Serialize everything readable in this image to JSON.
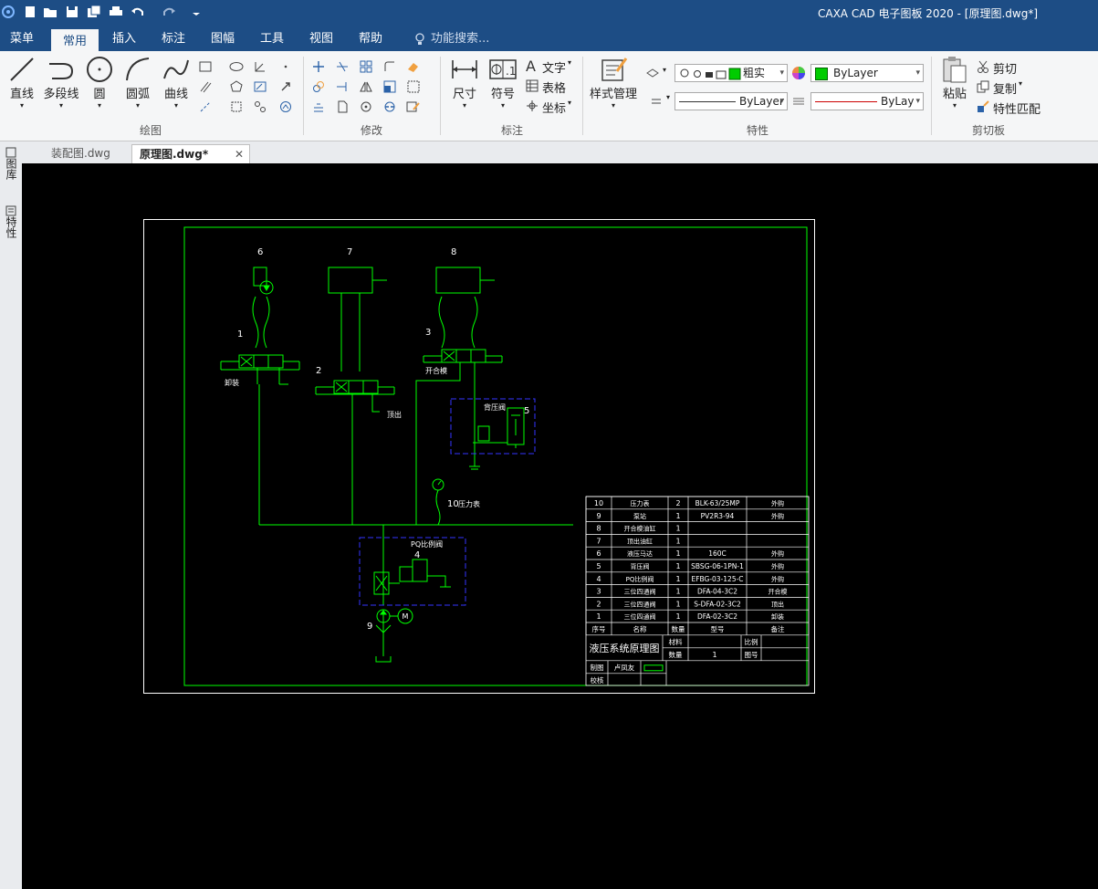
{
  "window": {
    "title": "CAXA CAD 电子图板 2020 - [原理图.dwg*]"
  },
  "quick_access": [
    "app-icon",
    "new-icon",
    "open-icon",
    "save-icon",
    "save-all-icon",
    "print-icon",
    "undo-icon",
    "redo-icon",
    "customize-icon"
  ],
  "menus": [
    "菜单",
    "常用",
    "插入",
    "标注",
    "图幅",
    "工具",
    "视图",
    "帮助"
  ],
  "active_menu": "常用",
  "search_placeholder": "功能搜索...",
  "ribbon": {
    "draw": {
      "label": "绘图",
      "big": [
        "直线",
        "多段线",
        "圆",
        "圆弧",
        "曲线"
      ]
    },
    "modify": {
      "label": "修改"
    },
    "annotate": {
      "label": "标注",
      "big": [
        "尺寸",
        "符号"
      ],
      "small": [
        "文字",
        "表格",
        "坐标"
      ]
    },
    "props": {
      "label": "特性",
      "style_btn": "样式管理",
      "layer_value": "粗实",
      "color_value": "ByLayer",
      "linetype_value": "ByLayer",
      "linewidth_value": "ByLay"
    },
    "clipboard": {
      "label": "剪切板",
      "paste": "粘贴",
      "cut": "剪切",
      "copy": "复制",
      "match": "特性匹配"
    }
  },
  "doc_tabs": [
    {
      "label": "装配图.dwg",
      "active": false
    },
    {
      "label": "原理图.dwg*",
      "active": true
    }
  ],
  "left_tabs": [
    "图库",
    "特性"
  ],
  "colors": {
    "green": "#00ff00",
    "blue": "#3535ff",
    "white": "#ffffff",
    "dark_blue": "#1d4d85"
  },
  "drawing": {
    "component_numbers": [
      "6",
      "7",
      "8",
      "1",
      "2",
      "3",
      "5",
      "4",
      "9",
      "10"
    ],
    "labels": {
      "c1": "卸装",
      "c2": "顶出",
      "c3": "开合模",
      "c5": "背压阀",
      "c4": "PQ比例阀",
      "c10": "压力表",
      "motor": "M"
    },
    "bom_rows": [
      {
        "no": "10",
        "name": "压力表",
        "qty": "2",
        "model": "BLK-63/25MP",
        "note": "外购"
      },
      {
        "no": "9",
        "name": "泵站",
        "qty": "1",
        "model": "PV2R3-94",
        "note": "外购"
      },
      {
        "no": "8",
        "name": "开合模油缸",
        "qty": "1",
        "model": "",
        "note": ""
      },
      {
        "no": "7",
        "name": "顶出油缸",
        "qty": "1",
        "model": "",
        "note": ""
      },
      {
        "no": "6",
        "name": "液压马达",
        "qty": "1",
        "model": "160C",
        "note": "外购"
      },
      {
        "no": "5",
        "name": "背压阀",
        "qty": "1",
        "model": "SBSG-06-1PN-1",
        "note": "外购"
      },
      {
        "no": "4",
        "name": "PQ比例阀",
        "qty": "1",
        "model": "EFBG-03-125-C",
        "note": "外购"
      },
      {
        "no": "3",
        "name": "三位四通阀",
        "qty": "1",
        "model": "DFA-04-3C2",
        "note": "开合模"
      },
      {
        "no": "2",
        "name": "三位四通阀",
        "qty": "1",
        "model": "S-DFA-02-3C2",
        "note": "顶出"
      },
      {
        "no": "1",
        "name": "三位四通阀",
        "qty": "1",
        "model": "DFA-02-3C2",
        "note": "卸装"
      }
    ],
    "bom_header": {
      "no": "序号",
      "name": "名称",
      "qty": "数量",
      "model": "型号",
      "note": "备注"
    },
    "title_block": {
      "title": "液压系统原理图",
      "material": "材料",
      "scale": "比例",
      "qty": "数量",
      "qty_value": "1",
      "drawing_no": "图号",
      "drawn": "制图",
      "drawn_by": "卢凤友",
      "checked": "校核"
    }
  }
}
